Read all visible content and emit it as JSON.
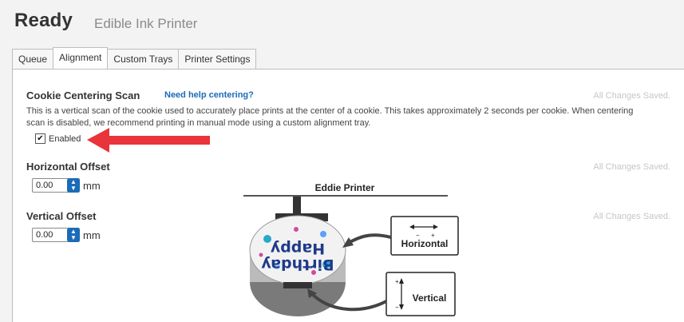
{
  "header": {
    "status": "Ready",
    "printer_name": "Edible Ink Printer"
  },
  "tabs": [
    {
      "label": "Queue",
      "active": false
    },
    {
      "label": "Alignment",
      "active": true
    },
    {
      "label": "Custom Trays",
      "active": false
    },
    {
      "label": "Printer Settings",
      "active": false
    }
  ],
  "cookie_scan": {
    "title": "Cookie Centering Scan",
    "help_link": "Need help centering?",
    "saved_status": "All Changes Saved.",
    "description": "This is a vertical scan of the cookie used to accurately place prints at the center of a cookie. This takes approximately 2 seconds per cookie. When centering scan is disabled, we recommend printing in manual mode using a custom alignment tray.",
    "enabled_label": "Enabled",
    "enabled": true
  },
  "horizontal_offset": {
    "title": "Horizontal Offset",
    "value": "0.00",
    "unit": "mm",
    "saved_status": "All Changes Saved."
  },
  "vertical_offset": {
    "title": "Vertical Offset",
    "value": "0.00",
    "unit": "mm",
    "saved_status": "All Changes Saved."
  },
  "diagram": {
    "printer_label": "Eddie Printer",
    "horizontal_label": "Horizontal",
    "vertical_label": "Vertical",
    "cookie_text_line1": "Birthday",
    "cookie_text_line2": "Happy"
  },
  "colors": {
    "accent": "#1a6bb8",
    "callout_arrow": "#e8343a",
    "saved_text": "#c6c6c6"
  },
  "icons": [
    "checkbox-checked-icon",
    "spin-up-down-icon",
    "red-callout-arrow-icon",
    "horizontal-arrow-icon",
    "vertical-arrow-icon"
  ]
}
